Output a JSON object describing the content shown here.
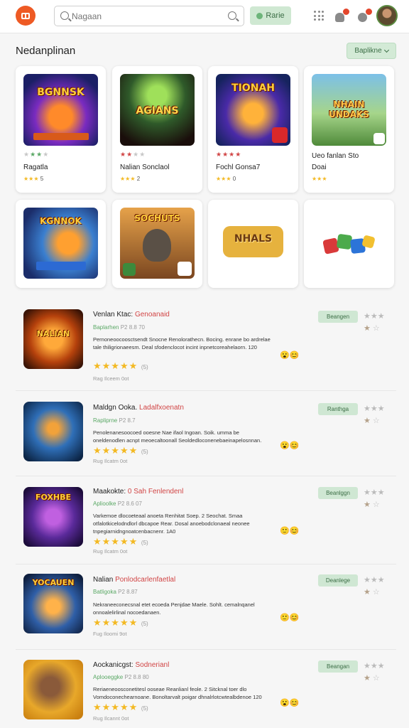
{
  "header": {
    "search_placeholder": "Nagaan",
    "action_button": "Rarie"
  },
  "section": {
    "title": "Nedanplinan",
    "sort_label": "Baplikne"
  },
  "cards": [
    {
      "art_title": "BGNNSK",
      "name": "Ragatla",
      "rating": "5",
      "stars": "★★★",
      "rating_stars": "★★★"
    },
    {
      "art_title": "AGIANS",
      "name": "Nalian Sonclaol",
      "rating": "2",
      "stars": "★★★",
      "rating_stars": "★★★"
    },
    {
      "art_title": "TIONAH",
      "name": "Fochl Gonsa7",
      "rating": "0",
      "stars": "★★★★",
      "rating_stars": "★★★"
    },
    {
      "art_title": "NHAIN UNDAKS",
      "name": "Ueo fanlan Sto",
      "rating": "Doai",
      "stars": "",
      "rating_stars": "★★★"
    },
    {
      "art_title": "KGNNOK",
      "name": "",
      "rating": "",
      "stars": "",
      "rating_stars": ""
    },
    {
      "art_title": "SOCHUTS",
      "name": "",
      "rating": "",
      "stars": "",
      "rating_stars": ""
    },
    {
      "art_title": "NHALS",
      "name": "",
      "rating": "",
      "stars": "",
      "rating_stars": ""
    },
    {
      "art_title": "",
      "name": "",
      "rating": "",
      "stars": "",
      "rating_stars": ""
    }
  ],
  "list": [
    {
      "title": "Venlan Ktac:",
      "subtitle": "Genoanaid",
      "meta": "Baplarhen",
      "meta_num": "P2 8.8 70",
      "desc": "Pernoneoocoosctsendt Snocne Renolorathecn. Bocing. enrane bo ardrelae tale thiligrionaeesm. Deal sfodenclocot incint inpnetcoreahelaorn. 120",
      "stars": "★★★★★",
      "count": "(5)",
      "foot": "Rag Ilceem 0ot",
      "btn": "Beangen"
    },
    {
      "title": "Maldgn Ooka.",
      "subtitle": "Ladalfxoenatn",
      "meta": "Rapliprne",
      "meta_num": "P2 8.7",
      "desc": "Penolenanesoocoed ooesne Nae ifaol Ingoan. Soik. umma be oneldenodlen acnpt meoecaltoonall Seoldedloconenebaeinapelosnnan.",
      "stars": "★★★★★",
      "count": "(5)",
      "foot": "Rug Ilcatm 0ot",
      "btn": "Ranthga"
    },
    {
      "title": "Maakokte:",
      "subtitle": "0 Sah Fenlendenl",
      "meta": "Aplioolke",
      "meta_num": "P2 8.6 07",
      "desc": "Varkemoe dlocoeteaal anoeta Renhitat Soep. 2 Seochat. Smaa otfalotkicelodndlorl dbcapoe Rear. Dosal anoebodclonaeal neonee tnpegiarnidngnoatcenbacnenr. 1A0",
      "stars": "★★★★★",
      "count": "(5)",
      "foot": "Rug Ilcatm 0ot",
      "btn": "Beanlggn"
    },
    {
      "title": "Nalian",
      "subtitle": "Ponlodcarlenfaetlal",
      "meta": "Batligoka",
      "meta_num": "P2 8.87",
      "desc": "Nekraneeconecsnal etet ecoeda Penjdae Maele. Sohlt. cemalnqanel onnoalelirlinal nocoedanaen.",
      "stars": "★★★★★",
      "count": "(5)",
      "foot": "Fug Iloomi 9ot",
      "btn": "Deanlege"
    },
    {
      "title": "Aockanicgst:",
      "subtitle": "Sodnerianl",
      "meta": "Aplooeggke",
      "meta_num": "P2 8.8 80",
      "desc": "Reriaeneoosconetitesl ooseae Reanlianl feole. 2 Sitcknal toer dlo Vomdoconechearnoane. Bonoltarvalt poigar dhnalrlotcwtealbdenoe 120",
      "stars": "★★★★★",
      "count": "(5)",
      "foot": "Rug Ilcannt 0ot",
      "btn": "Beangan"
    }
  ],
  "colors": {
    "accent": "#ee5a24",
    "green": "#5aa865",
    "red": "#d14545",
    "star": "#f3b923"
  }
}
